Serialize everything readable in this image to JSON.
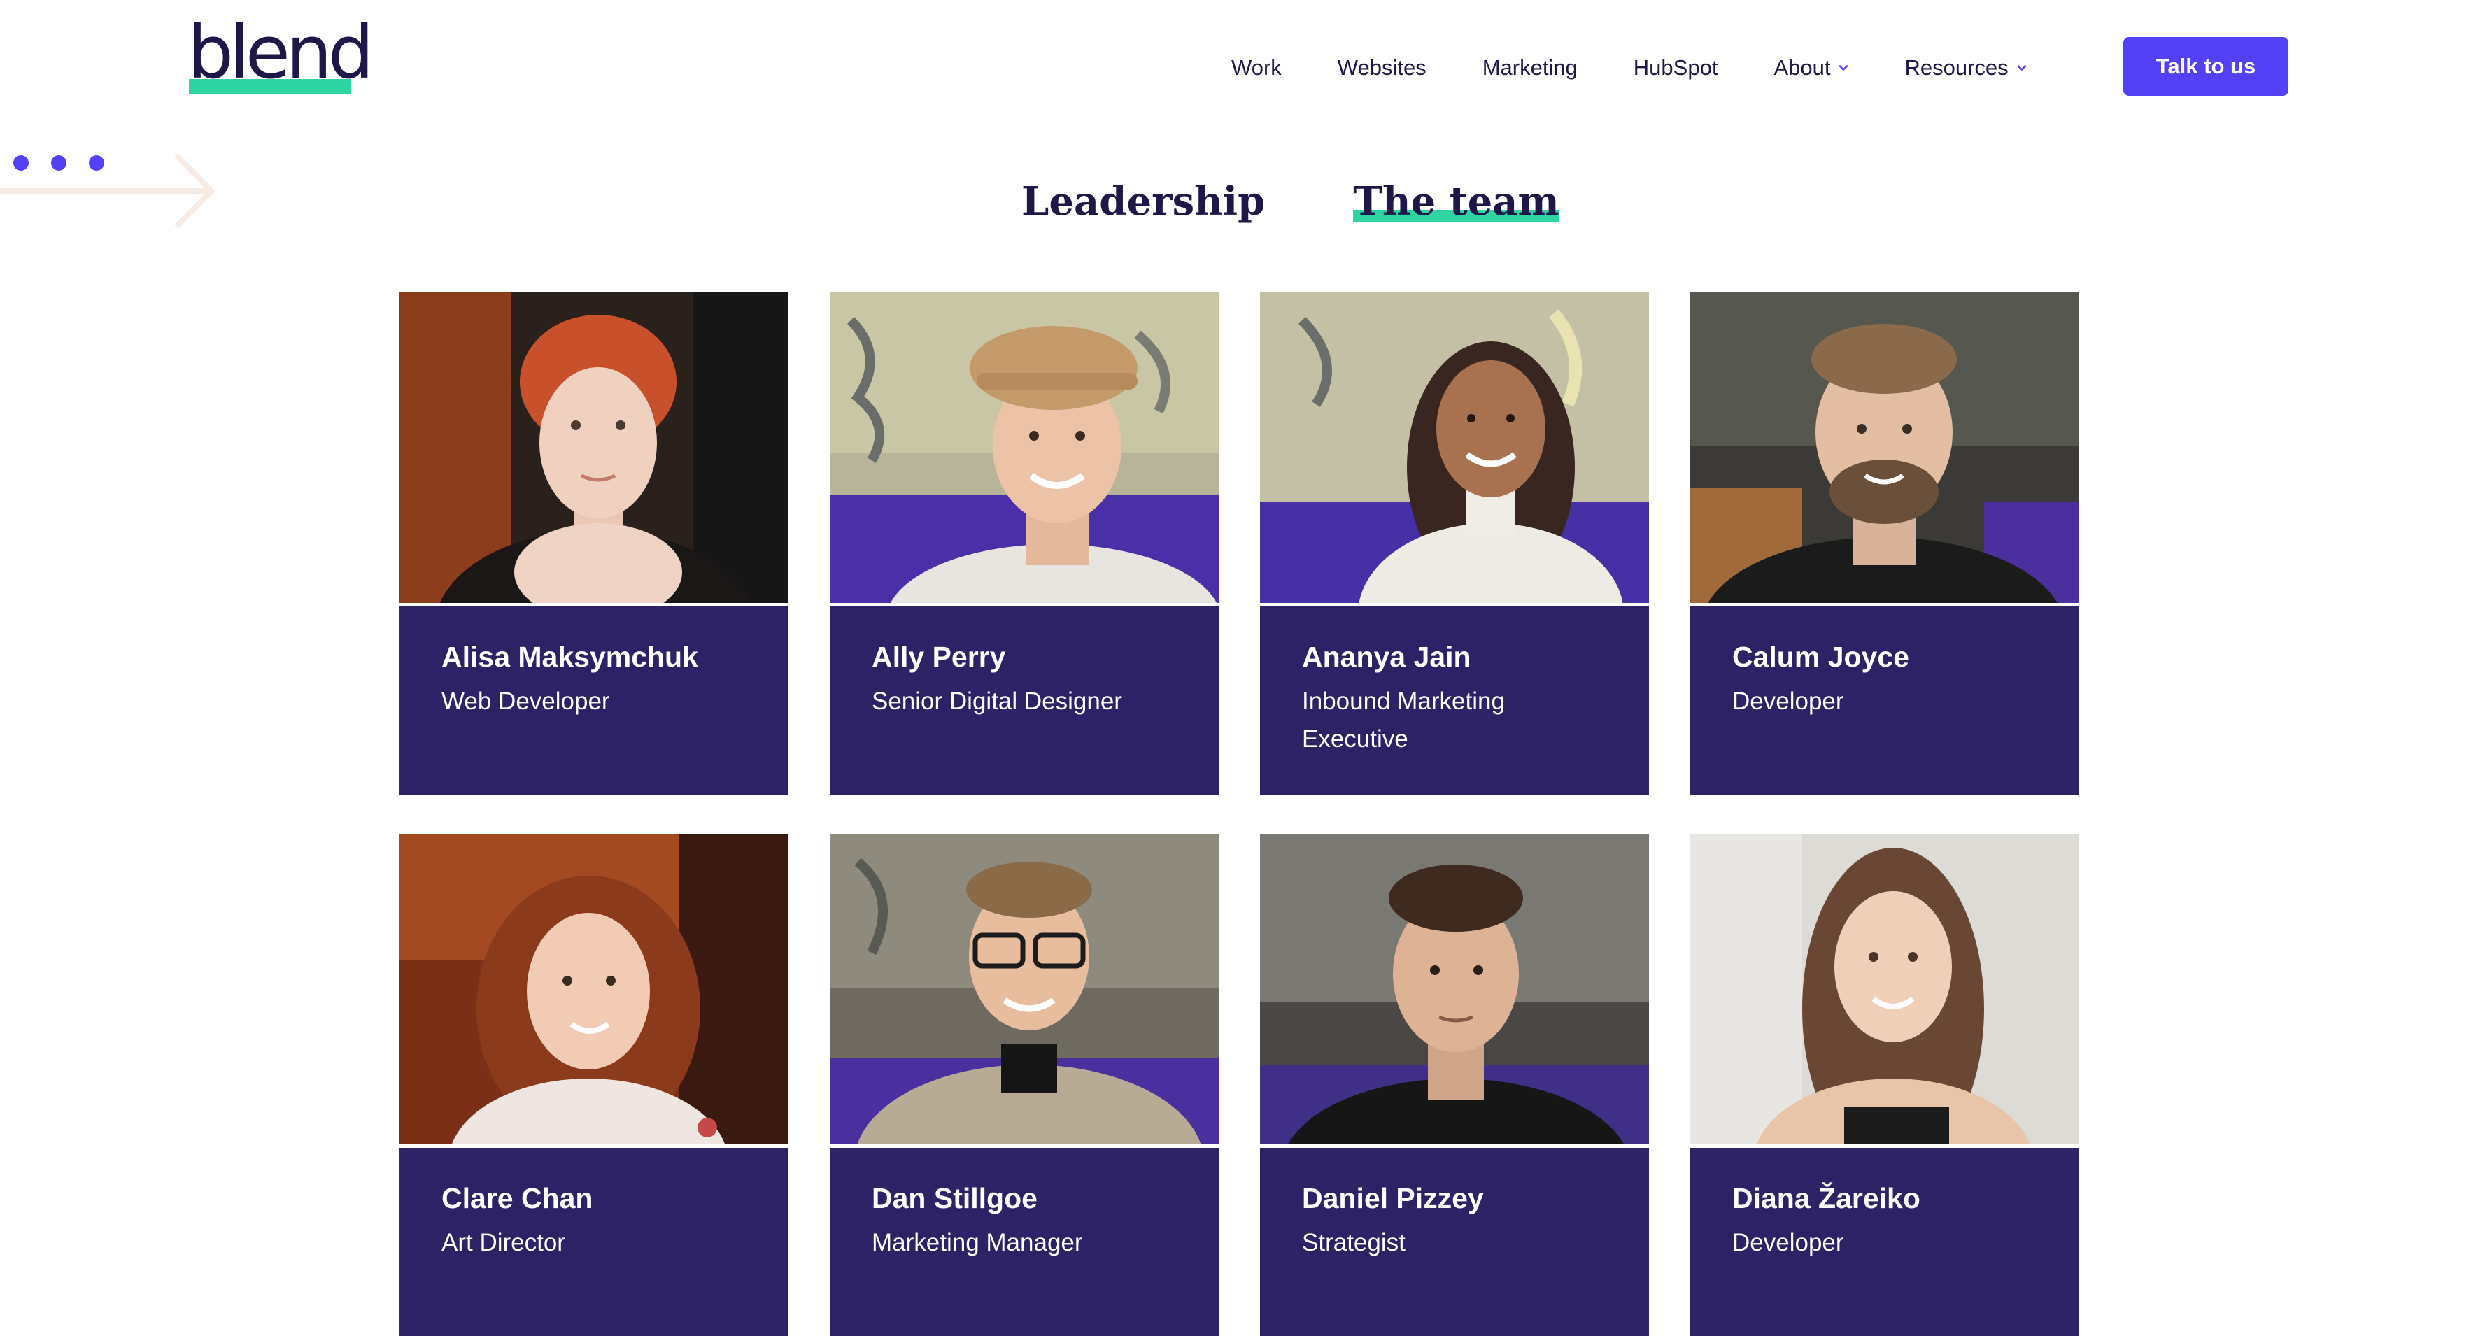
{
  "brand": {
    "logo_text": "blend",
    "accent_green": "#2fd4a3",
    "accent_purple": "#5440f5",
    "card_bg": "#2d2266",
    "text_dark": "#1d1848"
  },
  "nav": {
    "items": [
      {
        "label": "Work",
        "dropdown": false
      },
      {
        "label": "Websites",
        "dropdown": false
      },
      {
        "label": "Marketing",
        "dropdown": false
      },
      {
        "label": "HubSpot",
        "dropdown": false
      },
      {
        "label": "About",
        "dropdown": true
      },
      {
        "label": "Resources",
        "dropdown": true
      }
    ],
    "cta_label": "Talk to us"
  },
  "tabs": [
    {
      "label": "Leadership",
      "active": false
    },
    {
      "label": "The team",
      "active": true
    }
  ],
  "team": [
    {
      "name": "Alisa Maksymchuk",
      "role": "Web Developer"
    },
    {
      "name": "Ally Perry",
      "role": "Senior Digital Designer"
    },
    {
      "name": "Ananya Jain",
      "role": "Inbound Marketing Executive"
    },
    {
      "name": "Calum Joyce",
      "role": "Developer"
    },
    {
      "name": "Clare Chan",
      "role": "Art Director"
    },
    {
      "name": "Dan Stillgoe",
      "role": "Marketing Manager"
    },
    {
      "name": "Daniel Pizzey",
      "role": "Strategist"
    },
    {
      "name": "Diana Žareiko",
      "role": "Developer"
    }
  ]
}
